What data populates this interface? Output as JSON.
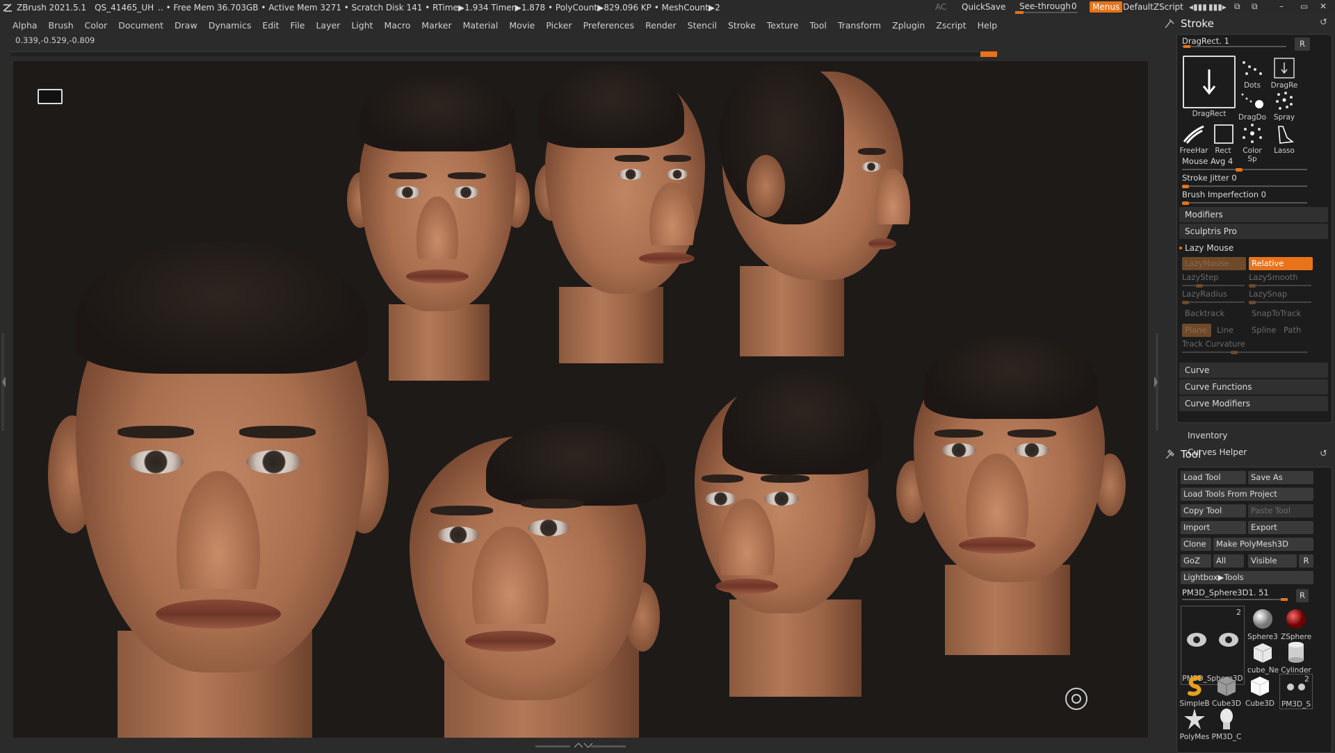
{
  "titlebar": {
    "app": "ZBrush 2021.5.1",
    "file": "QS_41465_UH",
    "status": ".. • Free Mem 36.703GB • Active Mem 3271 • Scratch Disk 141 • RTime▶1.934 Timer▶1.878 • PolyCount▶829.096 KP • MeshCount▶2",
    "ac": "AC",
    "quicksave": "QuickSave",
    "see_through": "See-through",
    "see_through_value": "0",
    "see_through_level": 0,
    "menus": "Menus",
    "zscript": "DefaultZScript"
  },
  "menu": [
    "Alpha",
    "Brush",
    "Color",
    "Document",
    "Draw",
    "Dynamics",
    "Edit",
    "File",
    "Layer",
    "Light",
    "Macro",
    "Marker",
    "Material",
    "Movie",
    "Picker",
    "Preferences",
    "Render",
    "Stencil",
    "Stroke",
    "Texture",
    "Tool",
    "Transform",
    "Zplugin",
    "Zscript",
    "Help"
  ],
  "coords": "0.339,-0.529,-0.809",
  "stroke": {
    "title": "Stroke",
    "drag_rect_label": "DragRect. 1",
    "r_label": "R",
    "thumbs": [
      {
        "label": "DragRect",
        "icon": "dragrect-arrow-icon"
      },
      {
        "label": "Dots",
        "icon": "dots-icon"
      },
      {
        "label": "DragRe",
        "icon": "dragrect-small-icon"
      },
      {
        "label": "DragDo",
        "icon": "dragdot-icon"
      },
      {
        "label": "Spray",
        "icon": "spray-icon"
      },
      {
        "label": "FreeHar",
        "icon": "freehand-icon"
      },
      {
        "label": "Rect",
        "icon": "rect-icon"
      },
      {
        "label": "Color Sp",
        "icon": "color-spray-icon"
      },
      {
        "label": "Lasso",
        "icon": "lasso-icon"
      }
    ],
    "mouse_avg": "Mouse Avg 4",
    "mouse_avg_level": 0.45,
    "stroke_jitter": "Stroke Jitter 0",
    "stroke_jitter_level": 0,
    "brush_imperfection": "Brush Imperfection 0",
    "brush_imperfection_level": 0,
    "modifiers": "Modifiers",
    "sculptris_pro": "Sculptris Pro",
    "lazy_mouse": "Lazy Mouse",
    "lazymouse_btn": "LazyMouse",
    "relative_btn": "Relative",
    "lazystep": "LazyStep",
    "lazysmooth": "LazySmooth",
    "lazyradius": "LazyRadius",
    "lazysnap": "LazySnap",
    "backtrack": "Backtrack",
    "snaptotrack": "SnapToTrack",
    "plane": "Plane",
    "line": "Line",
    "spline": "Spline",
    "path": "Path",
    "track_curvature": "Track Curvature",
    "curve": "Curve",
    "curve_functions": "Curve Functions",
    "curve_modifiers": "Curve Modifiers"
  },
  "inventory": "Inventory",
  "curves_helper": "Curves Helper",
  "tool": {
    "title": "Tool",
    "load_tool": "Load Tool",
    "save_as": "Save As",
    "load_from_project": "Load Tools From Project",
    "copy_tool": "Copy Tool",
    "paste_tool": "Paste Tool",
    "import": "Import",
    "export": "Export",
    "clone": "Clone",
    "make_polymesh": "Make PolyMesh3D",
    "goz": "GoZ",
    "all": "All",
    "visible": "Visible",
    "r": "R",
    "lightbox_tools": "Lightbox▶Tools",
    "current_tool": "PM3D_Sphere3D1. 51",
    "current_count": "2",
    "thumbs": [
      {
        "label": "PM3D_Sphere3D",
        "icon": "eyes-mesh-icon"
      },
      {
        "label": "Sphere3",
        "icon": "sphere-icon"
      },
      {
        "label": "ZSphere",
        "icon": "zsphere-icon"
      },
      {
        "label": "cube_Ne",
        "icon": "cube-ne-icon"
      },
      {
        "label": "Cylinder",
        "icon": "cylinder-icon"
      },
      {
        "label": "SimpleB",
        "icon": "simplebrush-icon"
      },
      {
        "label": "Cube3D",
        "icon": "cube3d-icon"
      },
      {
        "label": "Cube3D",
        "icon": "cube3d-white-icon"
      },
      {
        "label": "PM3D_S",
        "icon": "pm3d-eyes-icon"
      },
      {
        "label": "PolyMes",
        "icon": "polymesh-star-icon"
      },
      {
        "label": "PM3D_C",
        "icon": "pm3d-head-icon"
      }
    ],
    "pm3d_s_count": "2"
  },
  "colors": {
    "accent": "#e8731a",
    "panel": "#2b2b2b",
    "canvas": "#1e1a18"
  }
}
